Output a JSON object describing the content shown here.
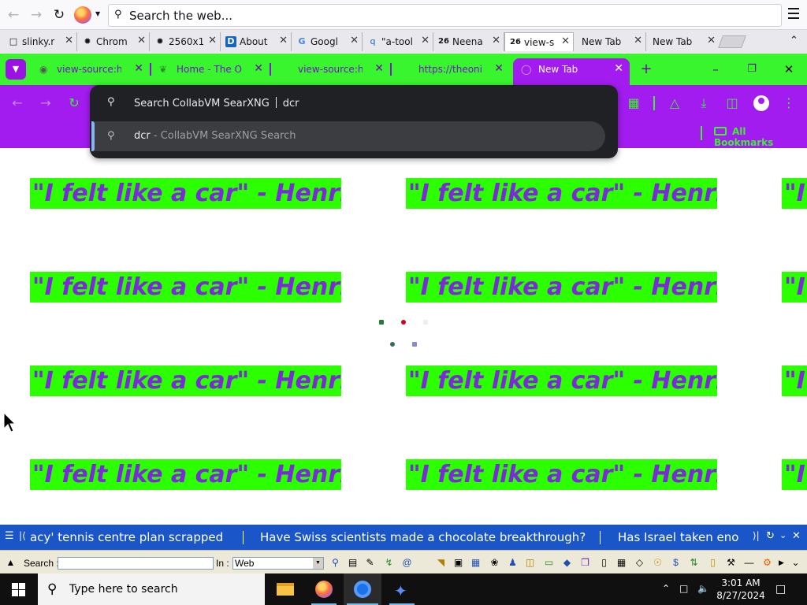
{
  "firefox": {
    "search_placeholder": "Search the web...",
    "tabs": [
      {
        "label": "slinky.r",
        "icon": "page-icon"
      },
      {
        "label": "Chrom",
        "icon": "chrome-icon"
      },
      {
        "label": "2560x1",
        "icon": "image-icon"
      },
      {
        "label": "About",
        "icon": "d-logo-icon"
      },
      {
        "label": "Googl",
        "icon": "google-icon"
      },
      {
        "label": "\"a-tool",
        "icon": "search-icon"
      },
      {
        "label": "Neena",
        "icon": "26-icon"
      },
      {
        "label": "view-s",
        "icon": "26-icon"
      },
      {
        "label": "New Tab",
        "icon": ""
      },
      {
        "label": "New Tab",
        "icon": ""
      }
    ]
  },
  "chrome": {
    "tabs": [
      {
        "label": "view-source:ht"
      },
      {
        "label": "Home - The O"
      },
      {
        "label": "view-source:ht"
      },
      {
        "label": "https://theoni"
      },
      {
        "label": "New Tab"
      }
    ],
    "bookmarks_label": "All Bookmarks",
    "accent": "#a21cf0",
    "secondary": "#39f52d"
  },
  "omnibox": {
    "keyword_prompt": "Search CollabVM SearXNG",
    "query": "dcr",
    "suggestion_term": "dcr",
    "suggestion_desc": " - CollabVM SearXNG Search"
  },
  "page": {
    "quote": "\"I felt like a car\" - Henrik"
  },
  "ticker": {
    "headlines": [
      "acy' tennis centre plan scrapped",
      "Have Swiss scientists made a chocolate breakthrough?",
      "Has Israel taken eno"
    ]
  },
  "searchbar": {
    "search_label": "Search :",
    "in_label": "In :",
    "in_value": "Web"
  },
  "taskbar": {
    "search_placeholder": "Type here to search",
    "time": "3:01 AM",
    "date": "8/27/2024"
  }
}
